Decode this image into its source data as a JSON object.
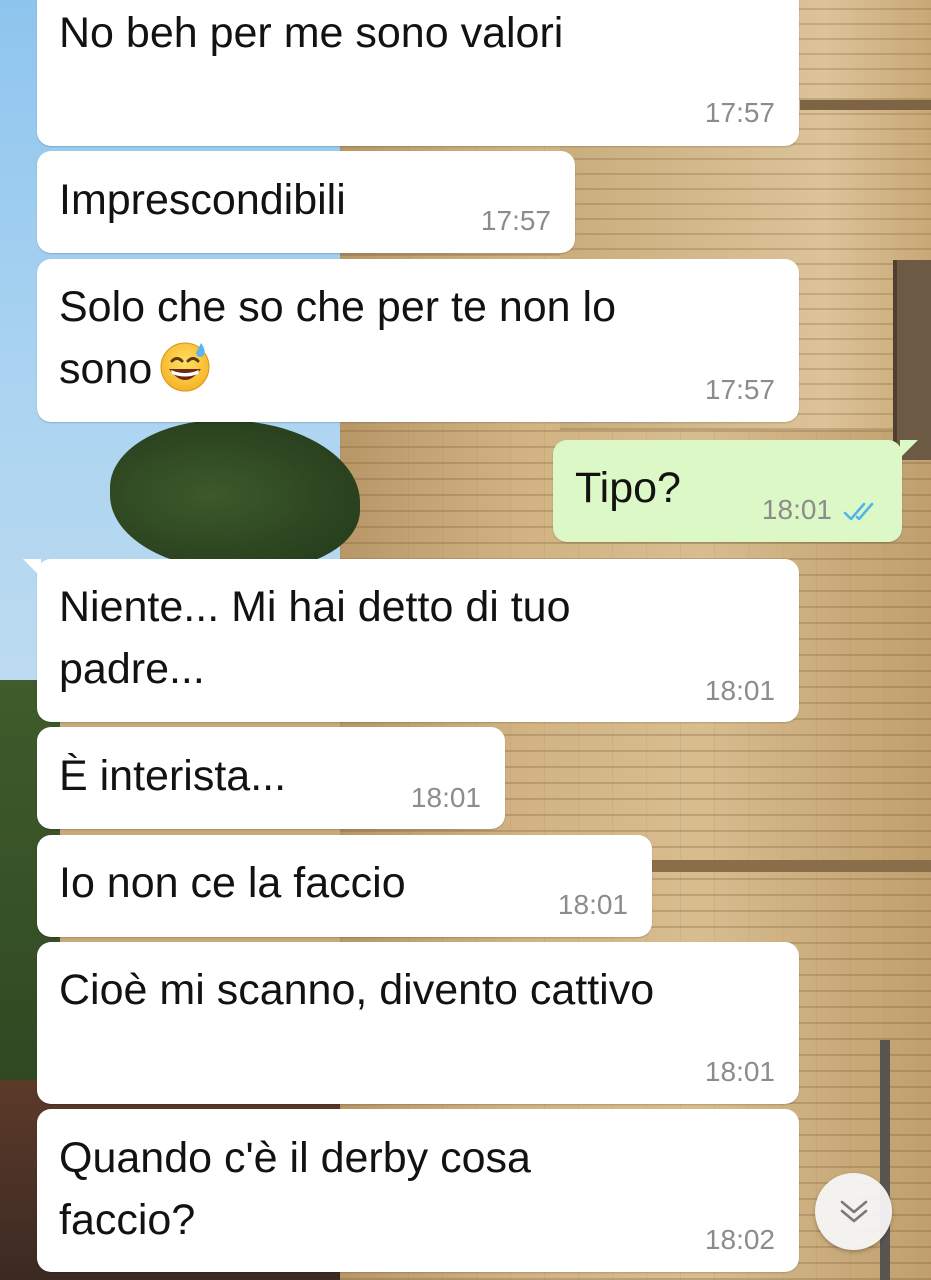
{
  "colors": {
    "incoming_bubble": "#ffffff",
    "outgoing_bubble": "#dcf8c6",
    "timestamp": "#8c8c8c",
    "read_ticks": "#4fb6ec"
  },
  "messages": [
    {
      "direction": "in",
      "text": "No beh per me sono valori",
      "time": "17:57"
    },
    {
      "direction": "in",
      "text": "Imprescondibili",
      "time": "17:57"
    },
    {
      "direction": "in",
      "text": "Solo che so che per te non lo\nsono",
      "emoji": "grinning-face-with-sweat",
      "time": "17:57"
    },
    {
      "direction": "out",
      "text": "Tipo?",
      "time": "18:01",
      "status": "read-double-check-icon"
    },
    {
      "direction": "in",
      "text": "Niente... Mi hai detto di tuo\npadre...",
      "time": "18:01"
    },
    {
      "direction": "in",
      "text": "È interista...",
      "time": "18:01"
    },
    {
      "direction": "in",
      "text": "Io non ce la faccio",
      "time": "18:01"
    },
    {
      "direction": "in",
      "text": "Cioè mi scanno, divento cattivo",
      "time": "18:01"
    },
    {
      "direction": "in",
      "text": "Quando c'è il derby cosa\nfaccio?",
      "time": "18:02"
    }
  ],
  "scroll_button": {
    "icon": "double-chevron-down-icon"
  }
}
